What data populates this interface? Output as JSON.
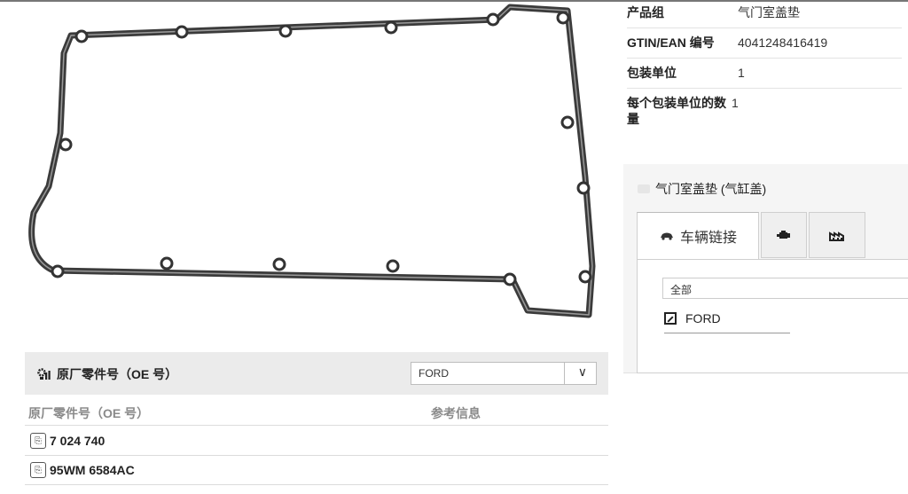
{
  "specs": [
    {
      "key": "产品组",
      "value": "气门室盖垫"
    },
    {
      "key": "GTIN/EAN 编号",
      "value": "4041248416419"
    },
    {
      "key": "包装单位",
      "value": "1"
    },
    {
      "key": "每个包装单位的数量",
      "value": "1"
    }
  ],
  "panel": {
    "title": "气门室盖垫 (气缸盖)",
    "tabs": [
      {
        "label": "车辆链接",
        "icon": "car-icon"
      },
      {
        "label": "",
        "icon": "engine-icon"
      },
      {
        "label": "",
        "icon": "factory-icon"
      }
    ],
    "filter_value": "全部",
    "manufacturer_link": "FORD"
  },
  "oe": {
    "title": "原厂零件号（OE 号）",
    "brand_select": "FORD",
    "col_number": "原厂零件号（OE 号）",
    "col_info": "参考信息",
    "rows": [
      "7 024 740",
      "95WM 6584AC"
    ]
  },
  "colors": {
    "gasket": "#3a3a3a",
    "panel_bg": "#f5f5f5",
    "header_bg": "#ebebeb"
  }
}
